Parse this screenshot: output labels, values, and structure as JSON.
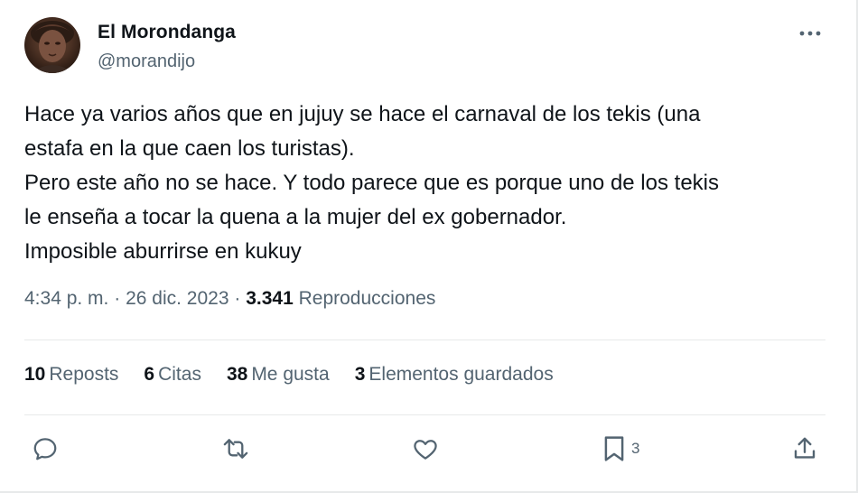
{
  "author": {
    "name": "El Morondanga",
    "handle": "@morandijo"
  },
  "tweet_text": "Hace ya varios años que en jujuy se hace el carnaval de los tekis (una\nestafa en la que caen los turistas).\nPero este año no se hace. Y todo parece que es porque uno de los tekis\nle enseña a tocar la quena a la mujer del ex gobernador.\nImposible aburrirse en kukuy",
  "meta": {
    "time": "4:34 p. m.",
    "sep1": "·",
    "date": "26 dic. 2023",
    "sep2": "·",
    "views_count": "3.341",
    "views_label": "Reproducciones"
  },
  "stats": [
    {
      "count": "10",
      "label": "Reposts"
    },
    {
      "count": "6",
      "label": "Citas"
    },
    {
      "count": "38",
      "label": "Me gusta"
    },
    {
      "count": "3",
      "label": "Elementos guardados"
    }
  ],
  "actions": {
    "bookmark_count": "3"
  },
  "icons": {
    "more": "more-horizontal-icon",
    "reply": "reply-icon",
    "retweet": "retweet-icon",
    "like": "heart-icon",
    "bookmark": "bookmark-icon",
    "share": "share-icon"
  },
  "colors": {
    "text": "#0f1419",
    "secondary": "#536471",
    "divider": "#e7e9ea"
  }
}
